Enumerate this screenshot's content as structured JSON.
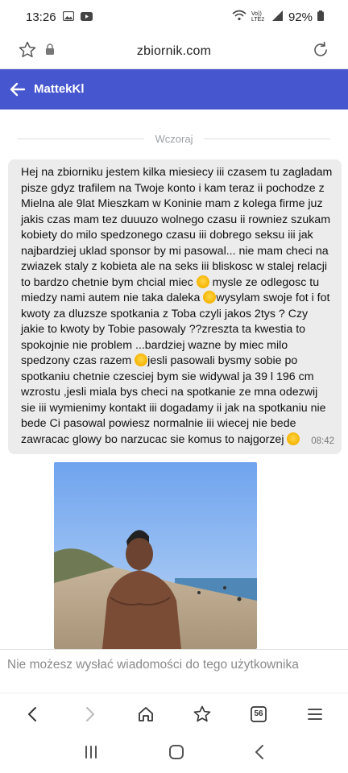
{
  "status_bar": {
    "time": "13:26",
    "battery": "92%",
    "network": "Vo)) LTE2"
  },
  "browser": {
    "url": "zbiornik.com"
  },
  "header": {
    "title": "MattekKl"
  },
  "chat": {
    "date_separator": "Wczoraj",
    "message": {
      "segments": [
        "Hej na zbiorniku jestem kilka miesiecy iii czasem tu zagladam pisze gdyz trafilem na Twoje konto i kam teraz ii pochodze z Mielna ale 9lat Mieszkam w Koninie mam z kolega firme juz jakis czas mam tez duuuzo wolnego czasu ii rowniez szukam kobiety do milo spedzonego czasu iii dobrego seksu iii jak najbardziej uklad sponsor by mi pasowal... nie mam checi na zwiazek staly z kobieta ale na seks iii bliskosc w stalej relacji to bardzo chetnie bym chcial miec ",
        " mysle ze odlegosc tu miedzy nami autem nie taka daleka ",
        "wysylam swoje fot i fot kwoty za dluzsze spotkania z Toba czyli jakos 2tys ? Czy jakie to kwoty by Tobie pasowaly ??zreszta ta kwestia to spokojnie nie problem ...bardziej wazne by miec milo spedzony czas razem ",
        "jesli pasowali bysmy sobie po spotkaniu chetnie czesciej bym sie widywal ja 39 l 196 cm wzrostu ,jesli miala bys checi na spotkanie ze mna odezwij sie iii wymienimy kontakt iii dogadamy ii jak na spotkaniu nie bede Ci pasowal powiesz normalnie iii wiecej nie bede zawracac glowy bo narzucac sie komus to najgorzej "
      ],
      "time": "08:42"
    }
  },
  "input": {
    "notice": "Nie możesz wysłać wiadomości do tego użytkownika"
  },
  "browser_nav": {
    "tabs_count": "56"
  },
  "colors": {
    "header_bg": "#4656cf",
    "bubble_bg": "#ececec",
    "emoji": "#f5b400"
  }
}
